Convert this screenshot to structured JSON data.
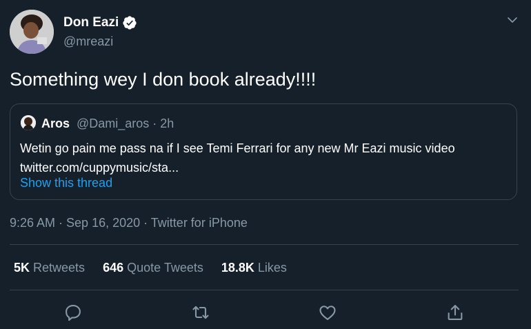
{
  "tweet": {
    "author_name": "Don Eazi",
    "author_handle": "@mreazi",
    "text": "Something wey I don book already!!!!"
  },
  "quoted": {
    "name": "Aros",
    "handle_time": "@Dami_aros · 2h",
    "text_line1": "Wetin go pain me pass na if I see Temi Ferrari for any new Mr Eazi music video",
    "text_line2": "twitter.com/cuppymusic/sta...",
    "show_thread": "Show this thread"
  },
  "meta": {
    "timestamp": "9:26 AM · Sep 16, 2020 · Twitter for iPhone"
  },
  "stats": {
    "retweets_count": "5K",
    "retweets_label": "Retweets",
    "quotes_count": "646",
    "quotes_label": "Quote Tweets",
    "likes_count": "18.8K",
    "likes_label": "Likes"
  },
  "colors": {
    "background": "#15202b",
    "secondary_text": "#8899a6",
    "link": "#1da1f2",
    "border": "#38444d"
  },
  "icons": [
    "verified-badge-icon",
    "chevron-down-icon",
    "reply-icon",
    "retweet-icon",
    "like-icon",
    "share-icon"
  ]
}
